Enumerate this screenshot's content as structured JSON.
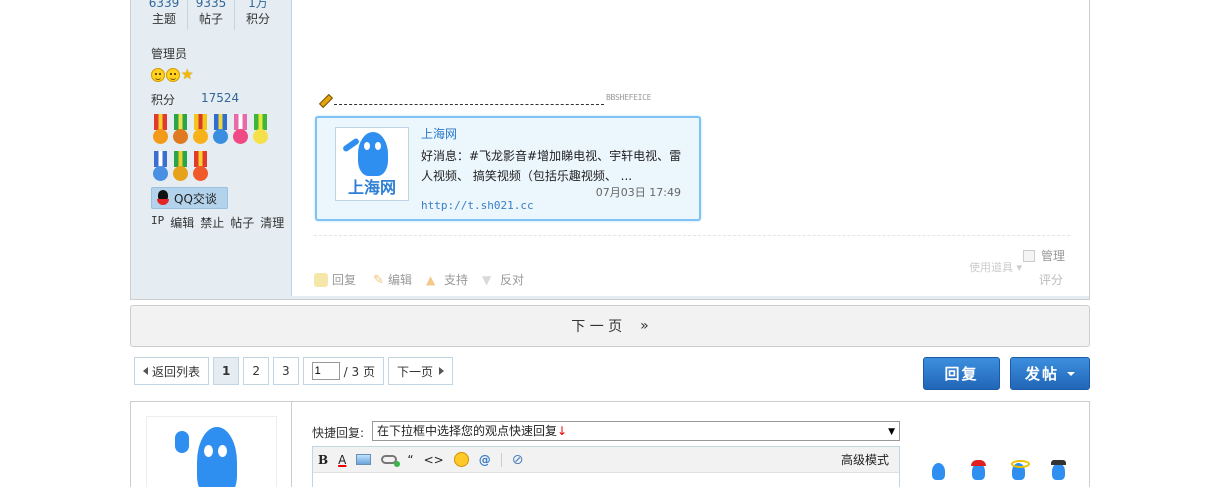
{
  "author": {
    "stats": [
      {
        "value": "6339",
        "label": "主题"
      },
      {
        "value": "9335",
        "label": "帖子"
      },
      {
        "value": "1万",
        "label": "积分"
      }
    ],
    "group": "管理员",
    "points_label": "积分",
    "points_value": "17524",
    "qq_label": "QQ交谈",
    "admin_links": [
      "IP",
      "编辑",
      "禁止",
      "帖子",
      "清理"
    ]
  },
  "signature": {
    "mark": "BBSHEFEICE"
  },
  "share_card": {
    "site": "上海网",
    "logo_text": "上海网",
    "text": "好消息：#飞龙影音#增加睇电视、宇轩电视、雷人视频、 搞笑视频（包括乐趣视频、 ...",
    "date": "07月03日 17:49",
    "url": "http://t.sh021.cc"
  },
  "post_actions": {
    "manage": "管理",
    "tools": "使用道具",
    "rate": "评分",
    "reply": "回复",
    "edit": "编辑",
    "support": "支持",
    "oppose": "反对"
  },
  "next_bar": {
    "label": "下 一 页",
    "arrow": "»"
  },
  "pager": {
    "back": "返回列表",
    "pages": [
      "1",
      "2",
      "3"
    ],
    "input_value": "1",
    "total": "/ 3 页",
    "next": "下一页"
  },
  "buttons": {
    "reply": "回复",
    "post": "发帖"
  },
  "quick_reply": {
    "label": "快捷回复:",
    "select_value": "在下拉框中选择您的观点快速回复",
    "select_arrow_char": "↓",
    "toolbar": {
      "bold": "B",
      "color": "A",
      "quote": "“",
      "code": "<>",
      "at": "@",
      "advanced": "高级模式"
    }
  },
  "colors": {
    "side_bg": "#e5edf2",
    "link": "#336699",
    "button_blue": "#2266b7",
    "card_border": "#7fc2f5"
  }
}
